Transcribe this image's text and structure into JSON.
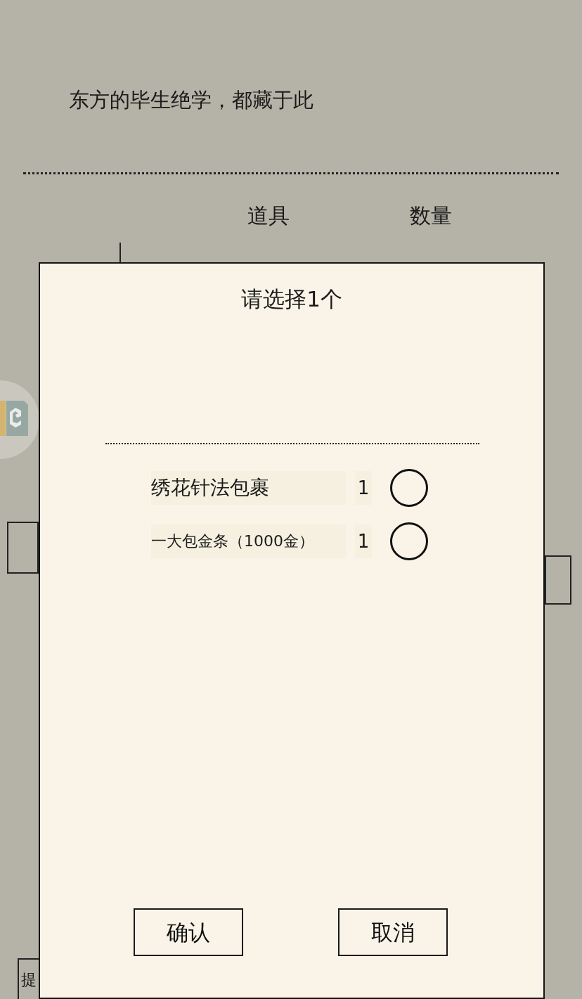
{
  "background": {
    "intro": "东方的毕生绝学，都藏于此",
    "columns": [
      "道具",
      "数量"
    ],
    "side_button": "提"
  },
  "dialog": {
    "title": "请选择1个",
    "items": [
      {
        "name": "绣花针法包裹",
        "quantity": "1",
        "selected": false
      },
      {
        "name": "一大包金条（1000金）",
        "quantity": "1",
        "selected": false
      }
    ],
    "buttons": [
      "确认",
      "取消"
    ]
  }
}
